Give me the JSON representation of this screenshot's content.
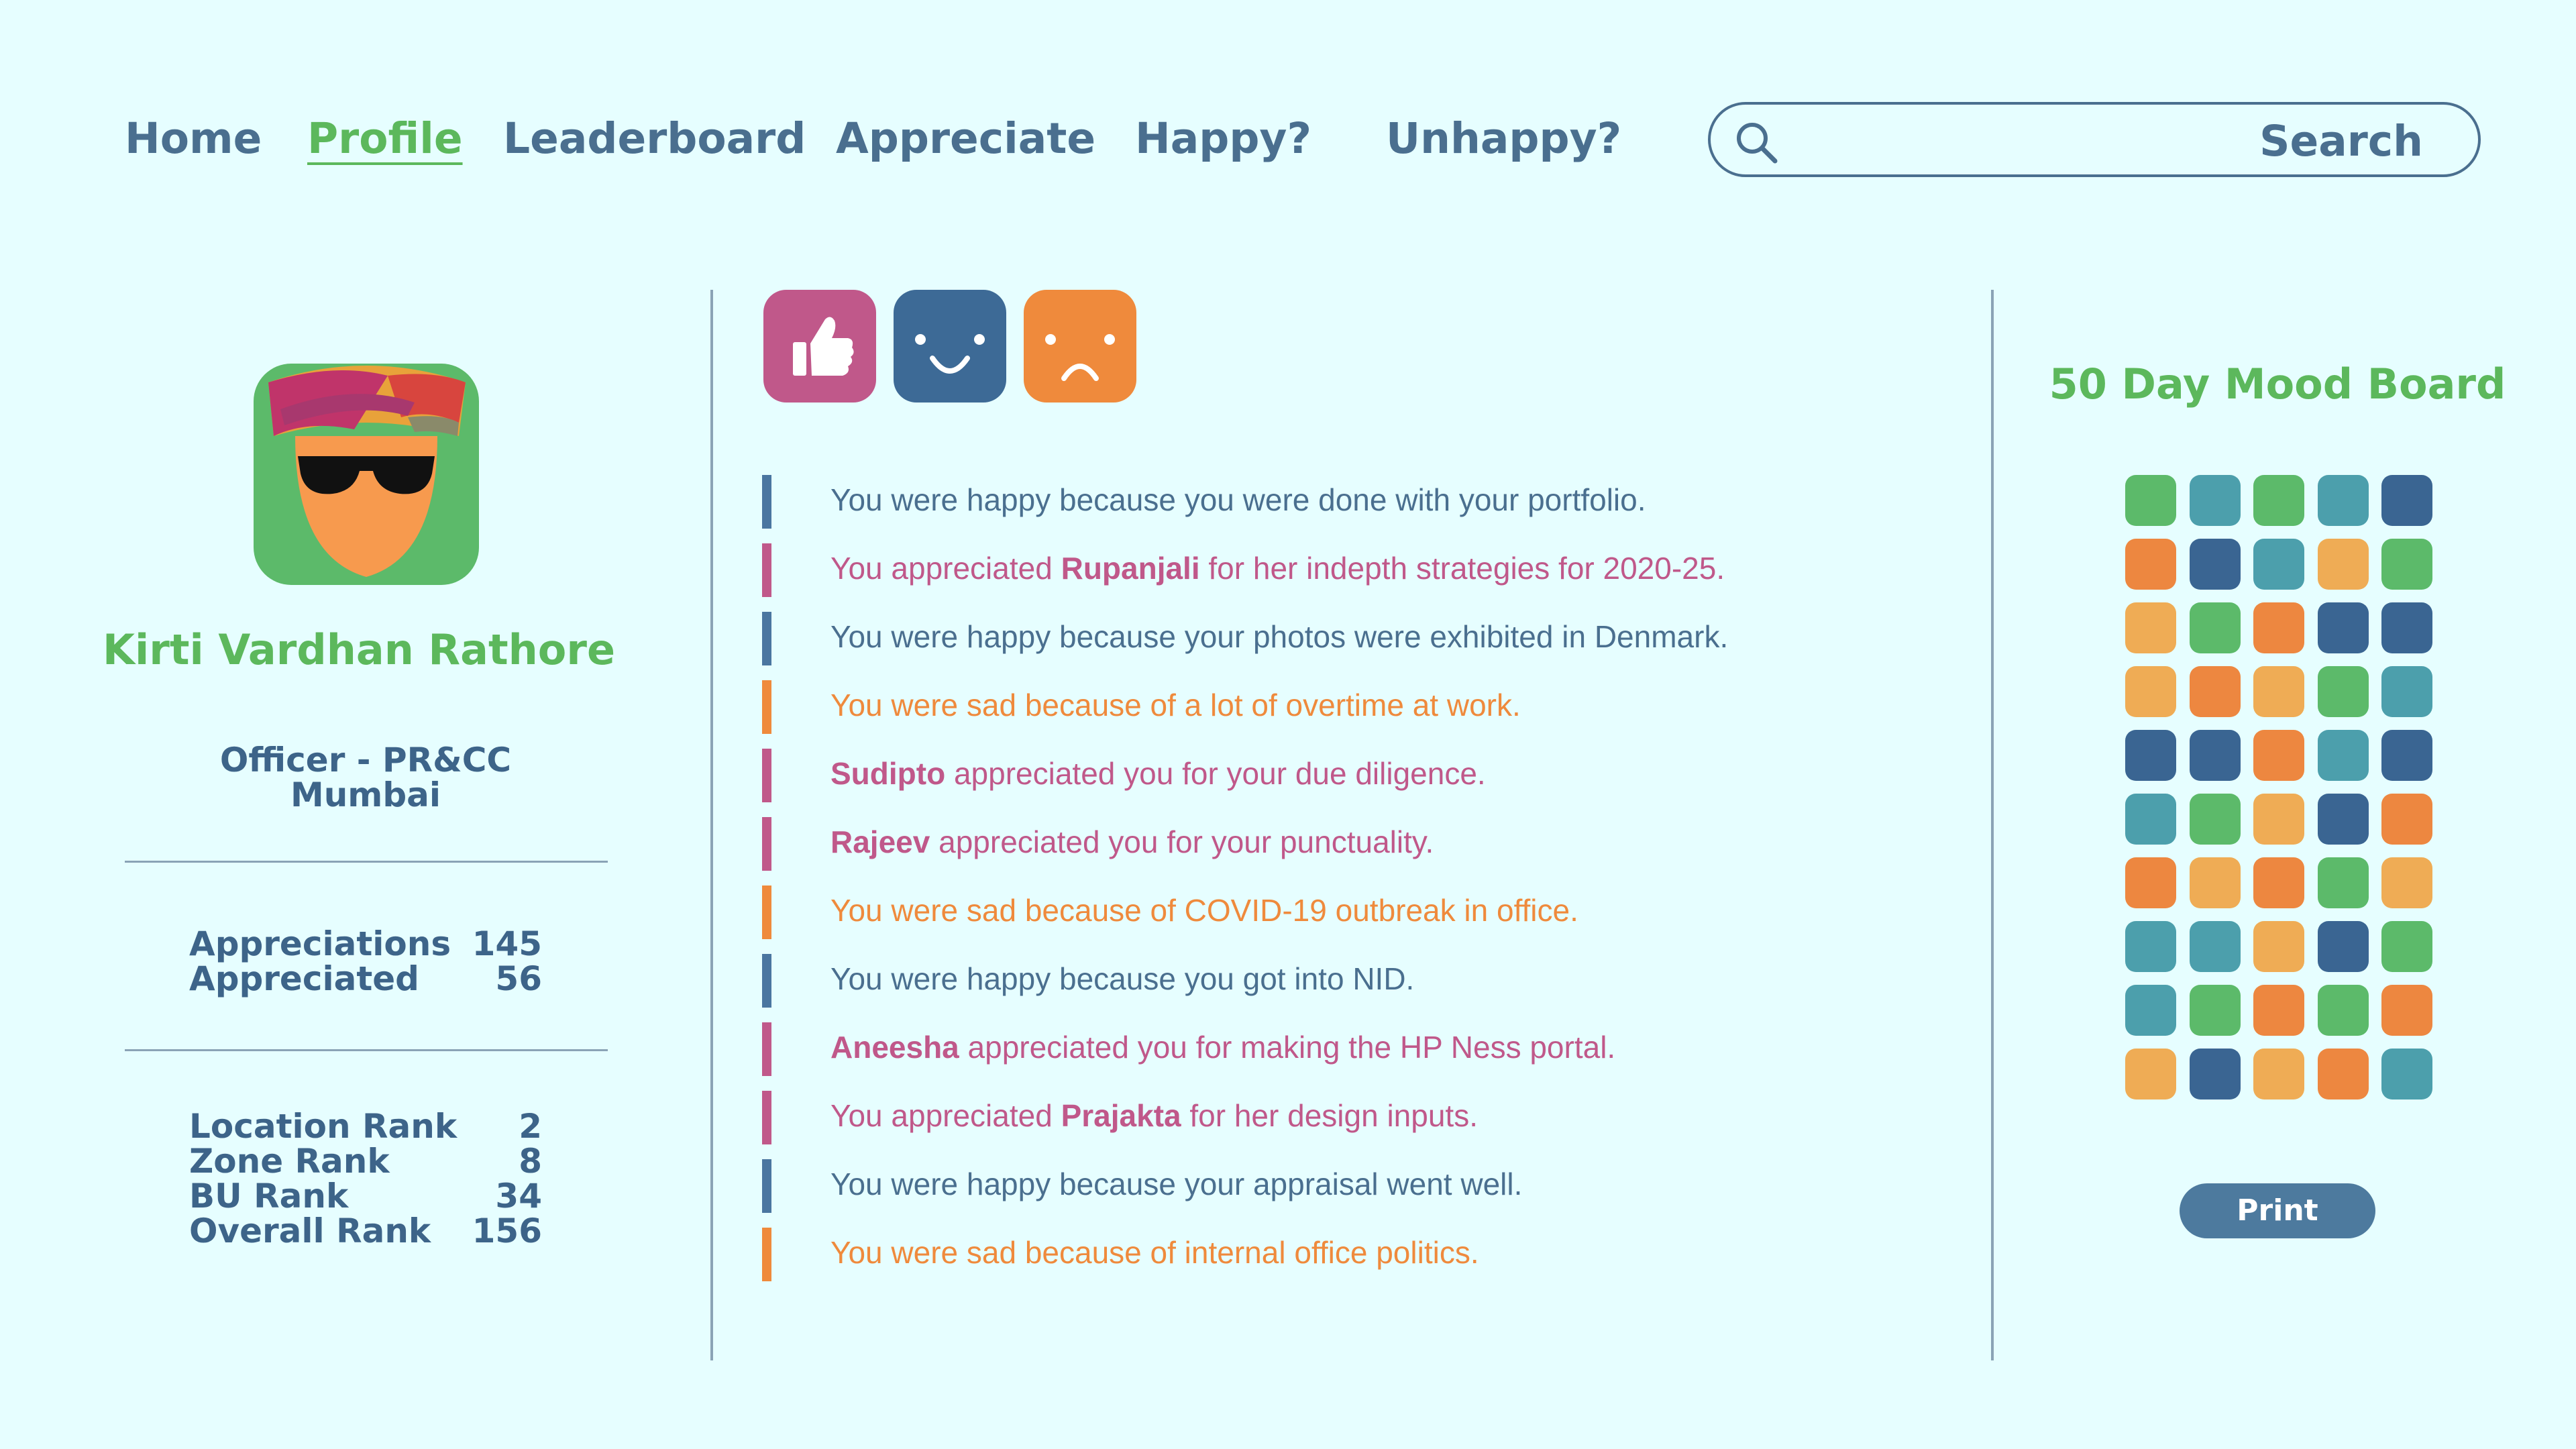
{
  "nav": {
    "items": [
      {
        "label": "Home",
        "active": false
      },
      {
        "label": "Profile",
        "active": true
      },
      {
        "label": "Leaderboard",
        "active": false
      },
      {
        "label": "Appreciate",
        "active": false
      },
      {
        "label": "Happy?",
        "active": false
      },
      {
        "label": "Unhappy?",
        "active": false
      }
    ],
    "search_label": "Search",
    "search_value": ""
  },
  "profile": {
    "name": "Kirti Vardhan Rathore",
    "title": "Officer - PR&CC",
    "location": "Mumbai",
    "stats": [
      {
        "label": "Appreciations",
        "value": "145"
      },
      {
        "label": "Appreciated",
        "value": "56"
      }
    ],
    "ranks": [
      {
        "label": "Location Rank",
        "value": "2"
      },
      {
        "label": "Zone Rank",
        "value": "8"
      },
      {
        "label": "BU Rank",
        "value": "34"
      },
      {
        "label": "Overall Rank",
        "value": "156"
      }
    ]
  },
  "mood_buttons": [
    {
      "icon": "thumbs-up-icon",
      "color": "#c0588a"
    },
    {
      "icon": "smile-icon",
      "color": "#3d6a96"
    },
    {
      "icon": "frown-icon",
      "color": "#ef8a3c"
    }
  ],
  "feed": [
    {
      "type": "happy",
      "before": "You were happy because you were done with your portfolio.",
      "bold": "",
      "after": ""
    },
    {
      "type": "appreciate",
      "before": "You appreciated ",
      "bold": "Rupanjali",
      "after": " for her indepth strategies for 2020-25."
    },
    {
      "type": "happy",
      "before": "You were happy because your photos were exhibited in Denmark.",
      "bold": "",
      "after": ""
    },
    {
      "type": "sad",
      "before": "You were sad because of a lot of overtime at work.",
      "bold": "",
      "after": ""
    },
    {
      "type": "appreciate",
      "before": "",
      "bold": "Sudipto",
      "after": " appreciated you for your due diligence."
    },
    {
      "type": "appreciate",
      "before": "",
      "bold": "Rajeev",
      "after": " appreciated you for your punctuality."
    },
    {
      "type": "sad",
      "before": "You were sad because of COVID-19 outbreak in office.",
      "bold": "",
      "after": ""
    },
    {
      "type": "happy",
      "before": "You were happy because you got into NID.",
      "bold": "",
      "after": ""
    },
    {
      "type": "appreciate",
      "before": "",
      "bold": "Aneesha",
      "after": " appreciated you for making the HP Ness portal."
    },
    {
      "type": "appreciate",
      "before": "You appreciated ",
      "bold": "Prajakta",
      "after": " for her design inputs."
    },
    {
      "type": "happy",
      "before": "You were happy because your appraisal went well.",
      "bold": "",
      "after": ""
    },
    {
      "type": "sad",
      "before": "You were sad because of internal office politics.",
      "bold": "",
      "after": ""
    }
  ],
  "mood_board": {
    "title": "50 Day Mood Board",
    "palette": {
      "G": "#5cba6a",
      "T": "#4c9fac",
      "N": "#3a6592",
      "O": "#ed8740",
      "Y": "#efac55"
    },
    "rows": [
      [
        "G",
        "T",
        "G",
        "T",
        "N"
      ],
      [
        "O",
        "N",
        "T",
        "Y",
        "G"
      ],
      [
        "Y",
        "G",
        "O",
        "N",
        "N"
      ],
      [
        "Y",
        "O",
        "Y",
        "G",
        "T"
      ],
      [
        "N",
        "N",
        "O",
        "T",
        "N"
      ],
      [
        "T",
        "G",
        "Y",
        "N",
        "O"
      ],
      [
        "O",
        "Y",
        "O",
        "G",
        "Y"
      ],
      [
        "T",
        "T",
        "Y",
        "N",
        "G"
      ],
      [
        "T",
        "G",
        "O",
        "G",
        "O"
      ],
      [
        "Y",
        "N",
        "Y",
        "O",
        "T"
      ]
    ],
    "print_label": "Print"
  }
}
